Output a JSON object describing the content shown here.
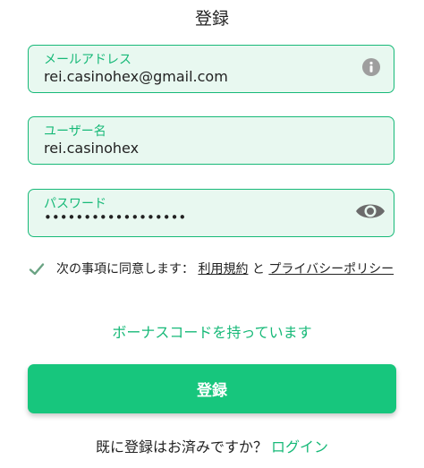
{
  "page": {
    "title": "登録"
  },
  "fields": {
    "email": {
      "label": "メールアドレス",
      "value": "rei.casinohex@gmail.com",
      "icon": "info-icon"
    },
    "username": {
      "label": "ユーザー名",
      "value": "rei.casinohex"
    },
    "password": {
      "label": "パスワード",
      "value": "••••••••••••••••••",
      "icon": "eye-icon"
    }
  },
  "agreement": {
    "checked": true,
    "text": "次の事項に同意します：",
    "terms_link": "利用規約",
    "conjunction": "と",
    "privacy_link": "プライバシーポリシー"
  },
  "bonus": {
    "link": "ボーナスコードを持っています"
  },
  "submit": {
    "label": "登録"
  },
  "footer": {
    "question": "既に登録はお済みですか？",
    "login_link": "ログイン"
  },
  "colors": {
    "accent": "#17b978",
    "button": "#17c67d",
    "field_bg": "#e8f8f0"
  }
}
